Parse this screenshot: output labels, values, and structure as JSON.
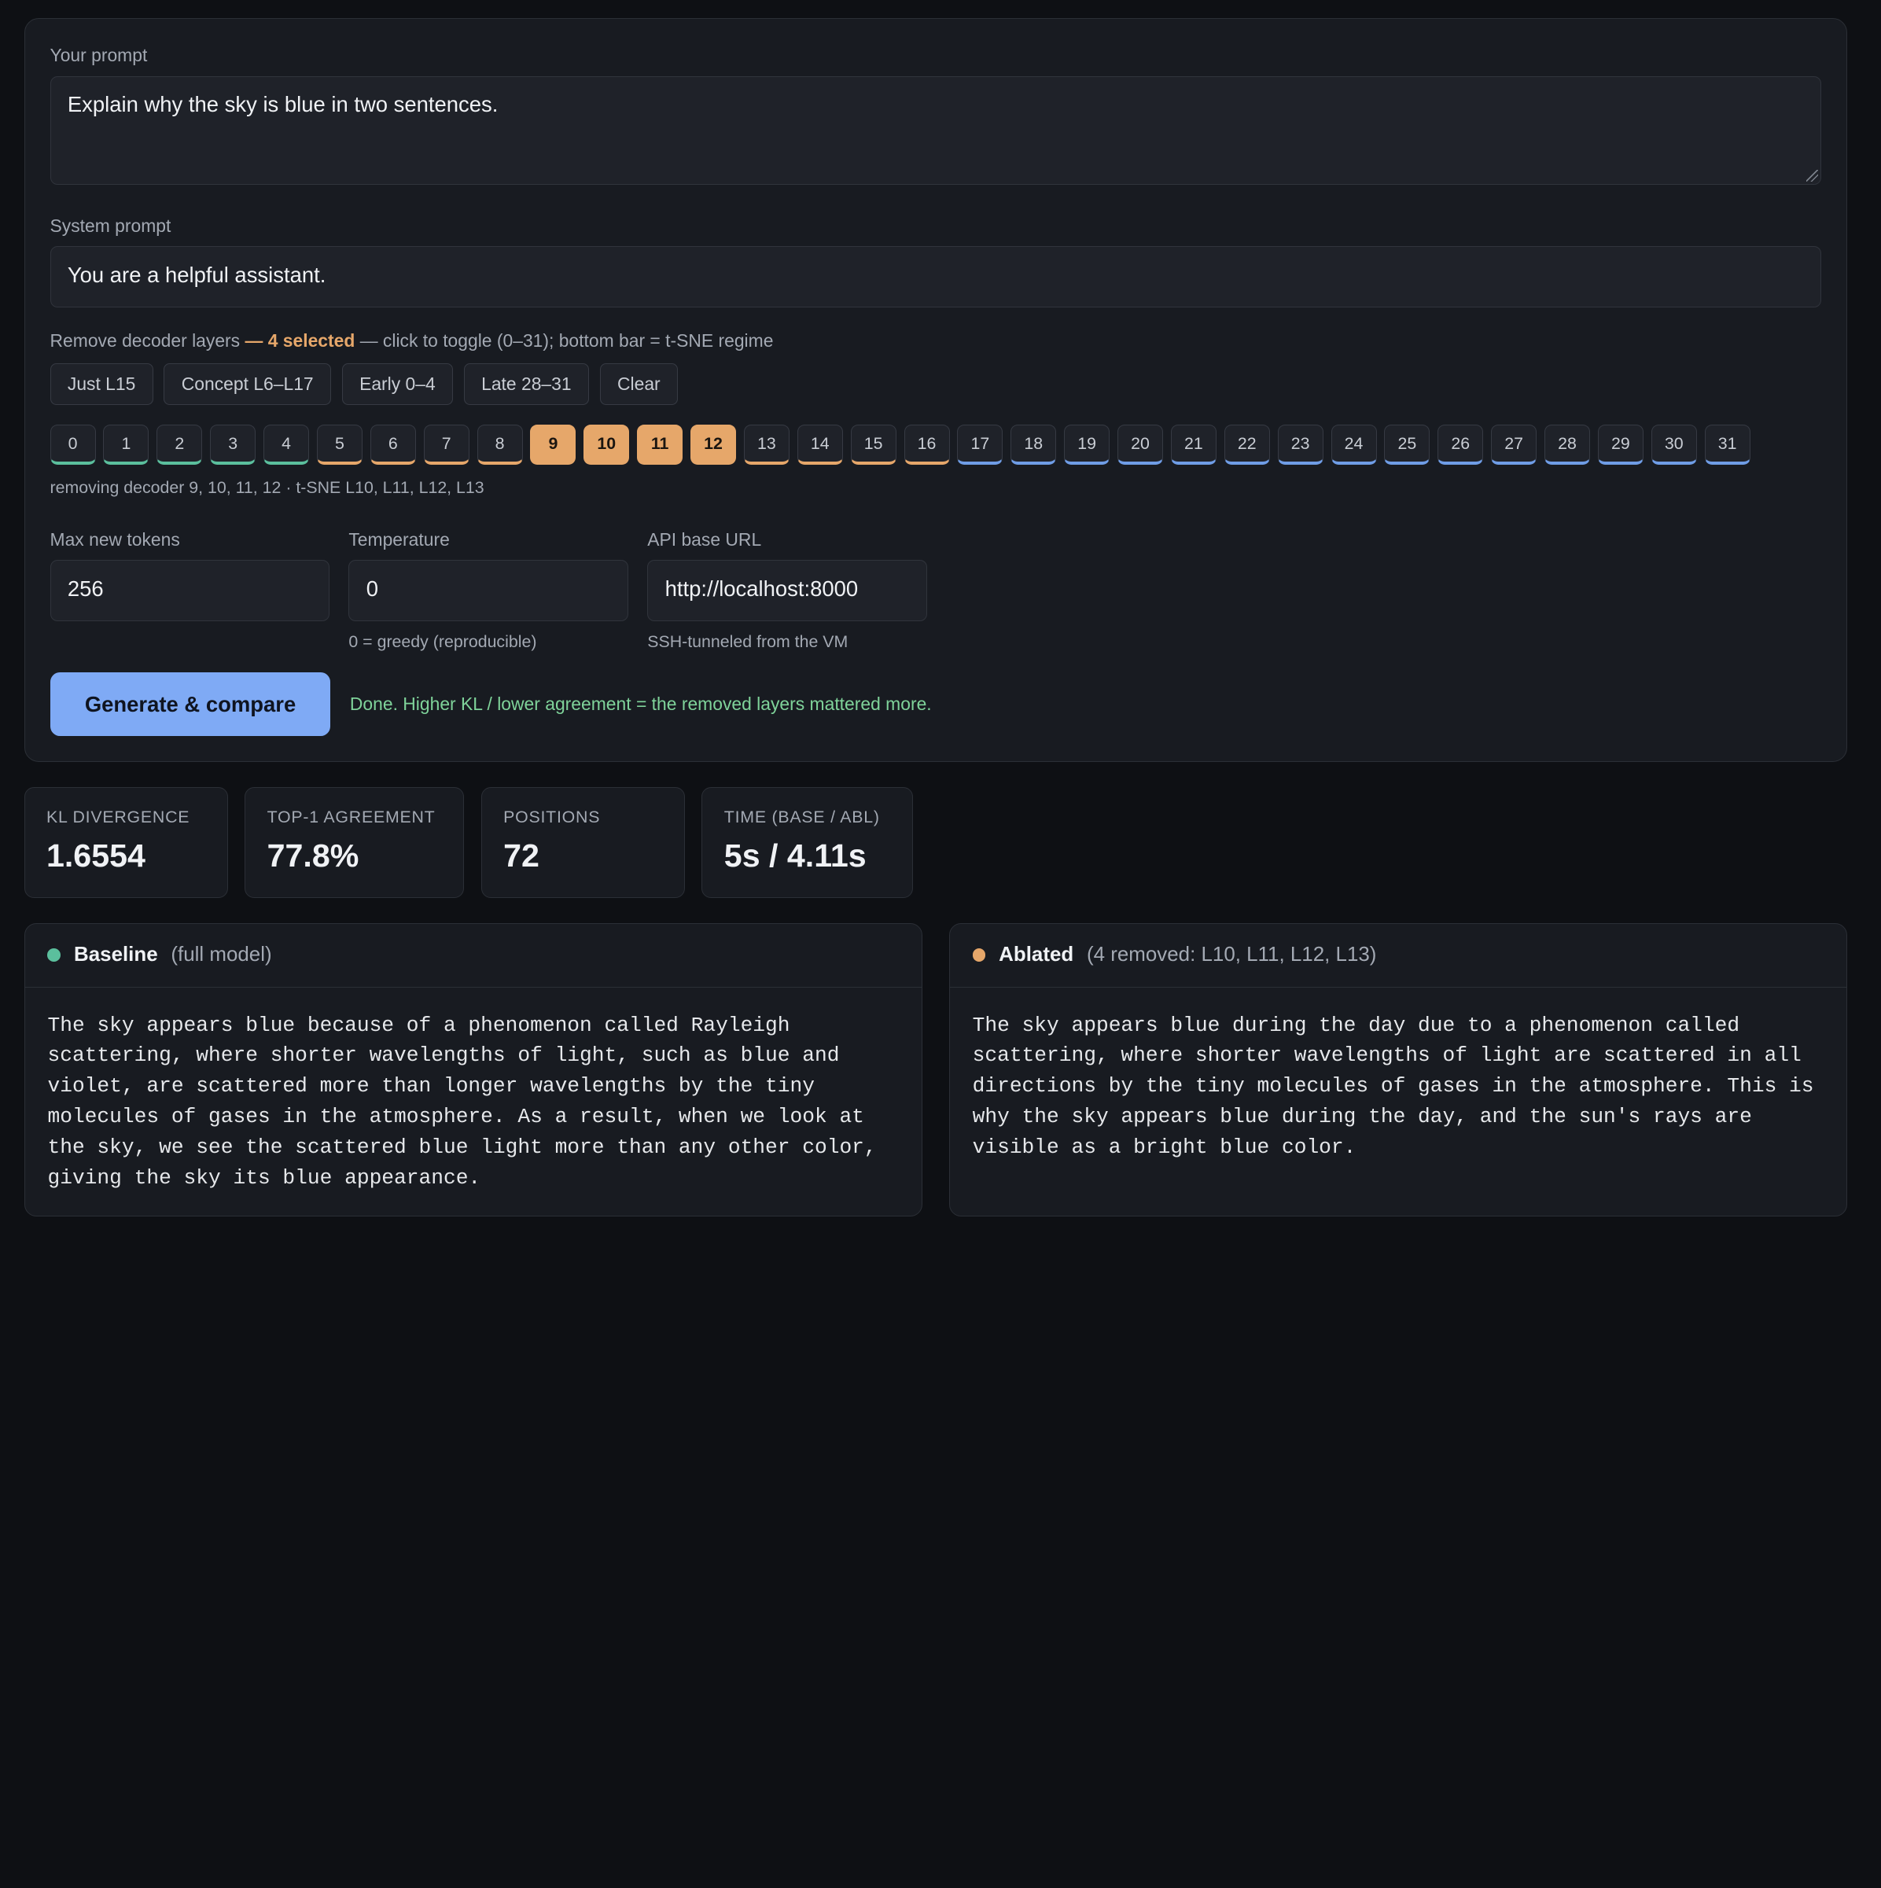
{
  "prompt": {
    "label": "Your prompt",
    "value": "Explain why the sky is blue in two sentences."
  },
  "system_prompt": {
    "label": "System prompt",
    "value": "You are a helpful assistant."
  },
  "layers": {
    "caption_prefix": "Remove decoder layers",
    "caption_count": "— 4 selected",
    "caption_suffix": "— click to toggle (0–31); bottom bar = t-SNE regime",
    "presets": [
      "Just L15",
      "Concept L6–L17",
      "Early 0–4",
      "Late 28–31",
      "Clear"
    ],
    "chips": [
      {
        "label": "0",
        "regime": "early",
        "selected": false
      },
      {
        "label": "1",
        "regime": "early",
        "selected": false
      },
      {
        "label": "2",
        "regime": "early",
        "selected": false
      },
      {
        "label": "3",
        "regime": "early",
        "selected": false
      },
      {
        "label": "4",
        "regime": "early",
        "selected": false
      },
      {
        "label": "5",
        "regime": "mid",
        "selected": false
      },
      {
        "label": "6",
        "regime": "mid",
        "selected": false
      },
      {
        "label": "7",
        "regime": "mid",
        "selected": false
      },
      {
        "label": "8",
        "regime": "mid",
        "selected": false
      },
      {
        "label": "9",
        "regime": "mid",
        "selected": true
      },
      {
        "label": "10",
        "regime": "mid",
        "selected": true
      },
      {
        "label": "11",
        "regime": "mid",
        "selected": true
      },
      {
        "label": "12",
        "regime": "mid",
        "selected": true
      },
      {
        "label": "13",
        "regime": "mid",
        "selected": false
      },
      {
        "label": "14",
        "regime": "mid",
        "selected": false
      },
      {
        "label": "15",
        "regime": "mid",
        "selected": false
      },
      {
        "label": "16",
        "regime": "mid",
        "selected": false
      },
      {
        "label": "17",
        "regime": "late",
        "selected": false
      },
      {
        "label": "18",
        "regime": "late",
        "selected": false
      },
      {
        "label": "19",
        "regime": "late",
        "selected": false
      },
      {
        "label": "20",
        "regime": "late",
        "selected": false
      },
      {
        "label": "21",
        "regime": "late",
        "selected": false
      },
      {
        "label": "22",
        "regime": "late",
        "selected": false
      },
      {
        "label": "23",
        "regime": "late",
        "selected": false
      },
      {
        "label": "24",
        "regime": "late",
        "selected": false
      },
      {
        "label": "25",
        "regime": "late",
        "selected": false
      },
      {
        "label": "26",
        "regime": "late",
        "selected": false
      },
      {
        "label": "27",
        "regime": "late",
        "selected": false
      },
      {
        "label": "28",
        "regime": "late",
        "selected": false
      },
      {
        "label": "29",
        "regime": "late",
        "selected": false
      },
      {
        "label": "30",
        "regime": "late",
        "selected": false
      },
      {
        "label": "31",
        "regime": "late",
        "selected": false
      }
    ],
    "regime_colors": {
      "early": "#5bbf9d",
      "mid": "#e6a76a",
      "late": "#6f9de6"
    },
    "removing_text": "removing decoder 9, 10, 11, 12 · t-SNE L10, L11, L12, L13"
  },
  "params": {
    "max_tokens": {
      "label": "Max new tokens",
      "value": "256",
      "hint": ""
    },
    "temperature": {
      "label": "Temperature",
      "value": "0",
      "hint": "0 = greedy (reproducible)"
    },
    "api_base": {
      "label": "API base URL",
      "value": "http://localhost:8000",
      "hint": "SSH-tunneled from the VM"
    }
  },
  "actions": {
    "generate_label": "Generate & compare",
    "status": "Done. Higher KL / lower agreement = the removed layers mattered more."
  },
  "stats": [
    {
      "label": "KL DIVERGENCE",
      "value": "1.6554"
    },
    {
      "label": "TOP-1 AGREEMENT",
      "value": "77.8%"
    },
    {
      "label": "POSITIONS",
      "value": "72"
    },
    {
      "label": "TIME (BASE / ABL)",
      "value": "5s / 4.11s"
    }
  ],
  "baseline": {
    "title": "Baseline",
    "subtitle": "(full model)",
    "text": "The sky appears blue because of a phenomenon called Rayleigh scattering, where shorter wavelengths of light, such as blue and violet, are scattered more than longer wavelengths by the tiny molecules of gases in the atmosphere. As a result, when we look at the sky, we see the scattered blue light more than any other color, giving the sky its blue appearance."
  },
  "ablated": {
    "title": "Ablated",
    "subtitle": "(4 removed: L10, L11, L12, L13)",
    "text": "The sky appears blue during the day due to a phenomenon called scattering, where shorter wavelengths of light are scattered in all directions by the tiny molecules of gases in the atmosphere. This is why the sky appears blue during the day, and the sun's rays are visible as a bright blue color."
  }
}
